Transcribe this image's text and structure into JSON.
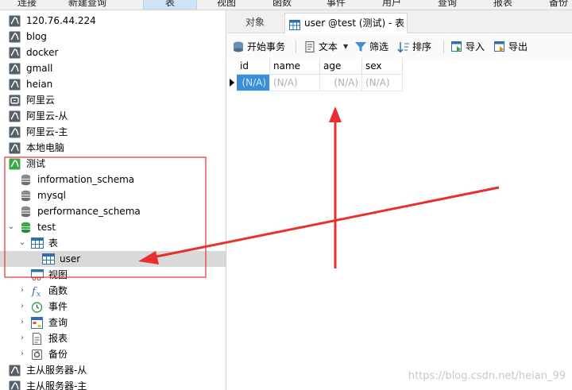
{
  "menubar": {
    "items": [
      {
        "label": "连接",
        "active": false
      },
      {
        "label": "新建查询",
        "active": false
      },
      {
        "label": "表",
        "active": true
      },
      {
        "label": "视图",
        "active": false
      },
      {
        "label": "函数",
        "active": false
      },
      {
        "label": "事件",
        "active": false
      },
      {
        "label": "用户",
        "active": false
      },
      {
        "label": "查询",
        "active": false
      },
      {
        "label": "报表",
        "active": false
      },
      {
        "label": "备份",
        "active": false
      }
    ]
  },
  "tree": {
    "connections_top": [
      {
        "label": "120.76.44.224",
        "icon": "mysql-connection-icon"
      },
      {
        "label": "blog",
        "icon": "mysql-connection-icon"
      },
      {
        "label": "docker",
        "icon": "mysql-connection-icon"
      },
      {
        "label": "gmall",
        "icon": "mysql-connection-icon"
      },
      {
        "label": "heian",
        "icon": "mysql-connection-icon"
      },
      {
        "label": "阿里云",
        "icon": "aliyun-connection-icon"
      },
      {
        "label": "阿里云-从",
        "icon": "mysql-connection-icon"
      },
      {
        "label": "阿里云-主",
        "icon": "mysql-connection-icon"
      },
      {
        "label": "本地电脑",
        "icon": "mysql-connection-icon"
      }
    ],
    "open_connection": {
      "label": "测试",
      "icon": "mysql-connection-open-icon"
    },
    "databases": [
      {
        "label": "information_schema"
      },
      {
        "label": "mysql"
      },
      {
        "label": "performance_schema"
      }
    ],
    "open_database": {
      "label": "test"
    },
    "tables_node": {
      "label": "表",
      "expanded": true
    },
    "table_user": {
      "label": "user",
      "selected": true
    },
    "object_nodes": [
      {
        "label": "视图",
        "icon": "view-icon",
        "arrow": ""
      },
      {
        "label": "函数",
        "icon": "function-icon",
        "arrow": "›"
      },
      {
        "label": "事件",
        "icon": "event-clock-icon",
        "arrow": "›"
      },
      {
        "label": "查询",
        "icon": "query-icon",
        "arrow": "›"
      },
      {
        "label": "报表",
        "icon": "report-icon",
        "arrow": "›"
      },
      {
        "label": "备份",
        "icon": "backup-icon",
        "arrow": "›"
      }
    ],
    "connections_bottom": [
      {
        "label": "主从服务器-从",
        "icon": "mysql-connection-icon"
      },
      {
        "label": "主从服务器-主",
        "icon": "mysql-connection-icon"
      }
    ]
  },
  "tabs": {
    "objects_label": "对象",
    "active_label": "user @test (测试) - 表"
  },
  "toolbar": {
    "begin_transaction": "开始事务",
    "text": "文本",
    "filter": "筛选",
    "sort": "排序",
    "import": "导入",
    "export": "导出"
  },
  "grid": {
    "columns": [
      "id",
      "name",
      "age",
      "sex"
    ],
    "rows": [
      [
        "(N/A)",
        "(N/A)",
        "(N/A)",
        "(N/A)"
      ]
    ]
  },
  "watermark": "https://blog.csdn.net/heian_99",
  "colors": {
    "accent_blue": "#3b8fd8",
    "annotation_red": "#e8302f",
    "selected_row": "#d9d9d9",
    "db_green": "#3aa84a"
  }
}
